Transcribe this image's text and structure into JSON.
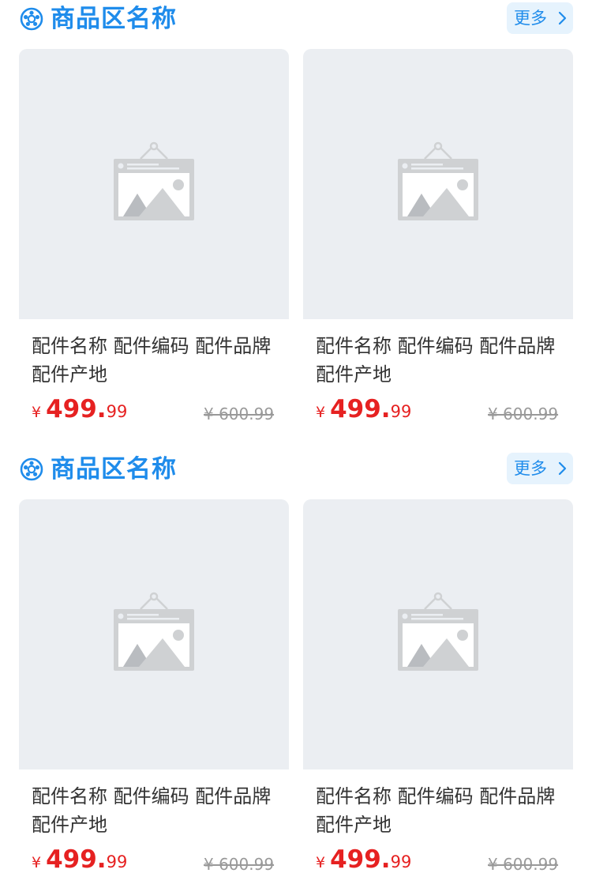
{
  "sections": [
    {
      "title": "商品区名称",
      "more_label": "更多",
      "products": [
        {
          "name": "配件名称 配件编码 配件品牌 配件产地",
          "currency": "¥",
          "price_int": "499.",
          "price_dec": "99",
          "original_price": "¥ 600.99"
        },
        {
          "name": "配件名称 配件编码 配件品牌 配件产地",
          "currency": "¥",
          "price_int": "499.",
          "price_dec": "99",
          "original_price": "¥ 600.99"
        }
      ]
    },
    {
      "title": "商品区名称",
      "more_label": "更多",
      "products": [
        {
          "name": "配件名称 配件编码 配件品牌 配件产地",
          "currency": "¥",
          "price_int": "499.",
          "price_dec": "99",
          "original_price": "¥ 600.99"
        },
        {
          "name": "配件名称 配件编码 配件品牌 配件产地",
          "currency": "¥",
          "price_int": "499.",
          "price_dec": "99",
          "original_price": "¥ 600.99"
        }
      ]
    }
  ],
  "icons": {
    "section_icon": "aperture-icon",
    "more_icon": "chevron-right-icon",
    "image_placeholder": "image-placeholder-icon"
  },
  "colors": {
    "accent": "#1f8ceb",
    "more_bg": "#e6f3fd",
    "price": "#e62121",
    "original_price": "#999999",
    "image_bg": "#ebeef2"
  }
}
